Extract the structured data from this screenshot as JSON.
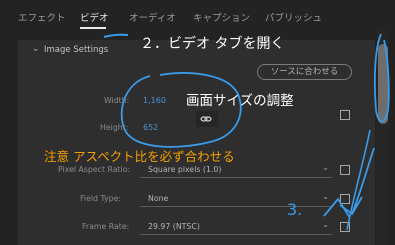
{
  "tabs": [
    {
      "label": "エフェクト"
    },
    {
      "label": "ビデオ",
      "active": true
    },
    {
      "label": "オーディオ"
    },
    {
      "label": "キャプション"
    },
    {
      "label": "パブリッシュ"
    }
  ],
  "section": {
    "title": "Image Settings"
  },
  "match_source_button": "ソースに合わせる",
  "fields": {
    "width": {
      "label": "Width:",
      "value": "1,160"
    },
    "height": {
      "label": "Height:",
      "value": "652"
    },
    "pixel_aspect": {
      "label": "Pixel Aspect Ratio:",
      "value": "Square pixels (1.0)"
    },
    "field_type": {
      "label": "Field Type:",
      "value": "None"
    },
    "frame_rate": {
      "label": "Frame Rate:",
      "value": "29.97 (NTSC)"
    }
  },
  "annotations": {
    "step2": "２．ビデオ タブを開く",
    "screen_size": "画面サイズの調整",
    "warning": "注意  アスペクト比を必ず合わせる",
    "step3": "3."
  },
  "colors": {
    "background": "#232323",
    "panel": "#2e2e2e",
    "accent_blue": "#4c92d8",
    "annotation_orange": "#f5a100",
    "annotation_ink": "#3a9be8"
  }
}
